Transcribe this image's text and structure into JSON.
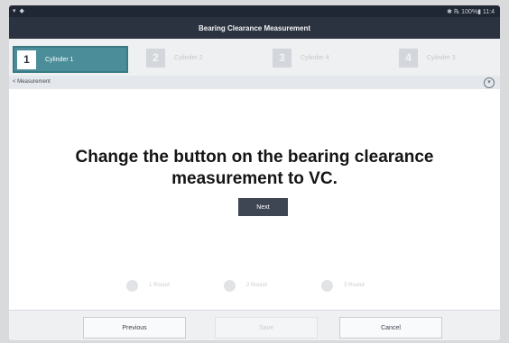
{
  "statusbar": {
    "left": "▾ ◆",
    "right": "✱ ℞ 100%▮ 11:4"
  },
  "title": "Bearing Clearance Measurement",
  "steps": [
    {
      "number": "1",
      "label": "Cylinder 1"
    },
    {
      "number": "2",
      "label": "Cylinder 2"
    },
    {
      "number": "3",
      "label": "Cylinder 4"
    },
    {
      "number": "4",
      "label": "Cylinder 3"
    }
  ],
  "section": {
    "title": "< Measurement"
  },
  "message": "Change the button on the bearing clearance measurement to VC.",
  "next_label": "Next",
  "rounds": [
    "1 Round",
    "2 Round",
    "3 Round"
  ],
  "footer": {
    "previous": "Previous",
    "save": "Save",
    "cancel": "Cancel"
  }
}
